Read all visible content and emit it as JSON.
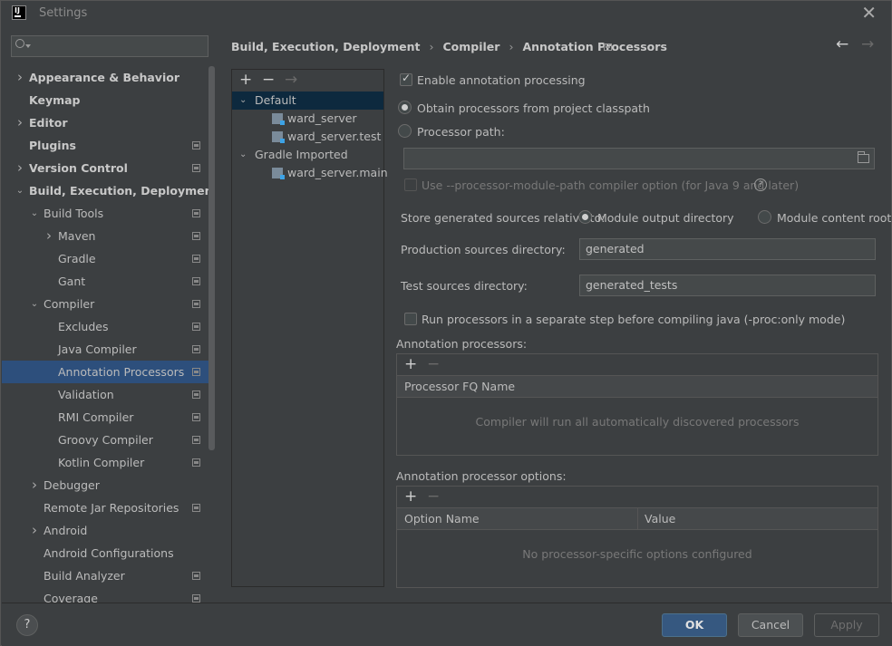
{
  "window": {
    "title": "Settings",
    "app_icon_text": "IJ"
  },
  "search": {
    "placeholder": ""
  },
  "sidebar": {
    "items": [
      {
        "label": "Appearance & Behavior",
        "bold": true,
        "arrow": "right",
        "level": 0
      },
      {
        "label": "Keymap",
        "bold": true,
        "arrow": "",
        "level": 0
      },
      {
        "label": "Editor",
        "bold": true,
        "arrow": "right",
        "level": 0
      },
      {
        "label": "Plugins",
        "bold": true,
        "arrow": "",
        "level": 0,
        "project": true
      },
      {
        "label": "Version Control",
        "bold": true,
        "arrow": "right",
        "level": 0,
        "project": true
      },
      {
        "label": "Build, Execution, Deployment",
        "bold": true,
        "arrow": "down",
        "level": 0
      },
      {
        "label": "Build Tools",
        "arrow": "down",
        "level": 1,
        "project": true
      },
      {
        "label": "Maven",
        "arrow": "right",
        "level": 2,
        "project": true
      },
      {
        "label": "Gradle",
        "arrow": "",
        "level": 2,
        "project": true
      },
      {
        "label": "Gant",
        "arrow": "",
        "level": 2,
        "project": true
      },
      {
        "label": "Compiler",
        "arrow": "down",
        "level": 1,
        "project": true
      },
      {
        "label": "Excludes",
        "arrow": "",
        "level": 2,
        "project": true
      },
      {
        "label": "Java Compiler",
        "arrow": "",
        "level": 2,
        "project": true
      },
      {
        "label": "Annotation Processors",
        "arrow": "",
        "level": 2,
        "project": true,
        "selected": true
      },
      {
        "label": "Validation",
        "arrow": "",
        "level": 2,
        "project": true
      },
      {
        "label": "RMI Compiler",
        "arrow": "",
        "level": 2,
        "project": true
      },
      {
        "label": "Groovy Compiler",
        "arrow": "",
        "level": 2,
        "project": true
      },
      {
        "label": "Kotlin Compiler",
        "arrow": "",
        "level": 2,
        "project": true
      },
      {
        "label": "Debugger",
        "arrow": "right",
        "level": 1
      },
      {
        "label": "Remote Jar Repositories",
        "arrow": "",
        "level": 1,
        "project": true
      },
      {
        "label": "Android",
        "arrow": "right",
        "level": 1
      },
      {
        "label": "Android Configurations",
        "arrow": "",
        "level": 1
      },
      {
        "label": "Build Analyzer",
        "arrow": "",
        "level": 1,
        "project": true
      },
      {
        "label": "Coverage",
        "arrow": "",
        "level": 1,
        "project": true
      }
    ]
  },
  "breadcrumb": {
    "items": [
      "Build, Execution, Deployment",
      "Compiler",
      "Annotation Processors"
    ],
    "sep": "›"
  },
  "nav": {
    "back": "←",
    "forward": "→"
  },
  "profiles": {
    "toolbar": {
      "add": "+",
      "remove": "−",
      "move": "→"
    },
    "rows": [
      {
        "label": "Default",
        "arrow": "down",
        "level": 0,
        "selected": true
      },
      {
        "label": "ward_server",
        "level": 1,
        "module": true
      },
      {
        "label": "ward_server.test",
        "level": 1,
        "module": true
      },
      {
        "label": "Gradle Imported",
        "arrow": "down",
        "level": 0
      },
      {
        "label": "ward_server.main",
        "level": 1,
        "module": true
      }
    ]
  },
  "settings": {
    "enable_processing": "Enable annotation processing",
    "obtain_from_classpath": "Obtain processors from project classpath",
    "processor_path": "Processor path:",
    "processor_path_value": "",
    "module_path_option": "Use --processor-module-path compiler option (for Java 9 and later)",
    "store_generated_label": "Store generated sources relative to:",
    "module_output_dir": "Module output directory",
    "module_content_root": "Module content root",
    "production_dir_label": "Production sources directory:",
    "production_dir_value": "generated",
    "test_dir_label": "Test sources directory:",
    "test_dir_value": "generated_tests",
    "separate_step": "Run processors in a separate step before compiling java (-proc:only mode)",
    "help_glyph": "?"
  },
  "processors_panel": {
    "label": "Annotation processors:",
    "add": "+",
    "remove": "−",
    "column": "Processor FQ Name",
    "empty_text": "Compiler will run all automatically discovered processors"
  },
  "options_panel": {
    "label": "Annotation processor options:",
    "add": "+",
    "remove": "−",
    "col_name": "Option Name",
    "col_value": "Value",
    "empty_text": "No processor-specific options configured"
  },
  "footer": {
    "help": "?",
    "ok": "OK",
    "cancel": "Cancel",
    "apply": "Apply"
  },
  "colors": {
    "accent": "#365880",
    "selection": "#2d4f7c",
    "background": "#3c3f41"
  }
}
